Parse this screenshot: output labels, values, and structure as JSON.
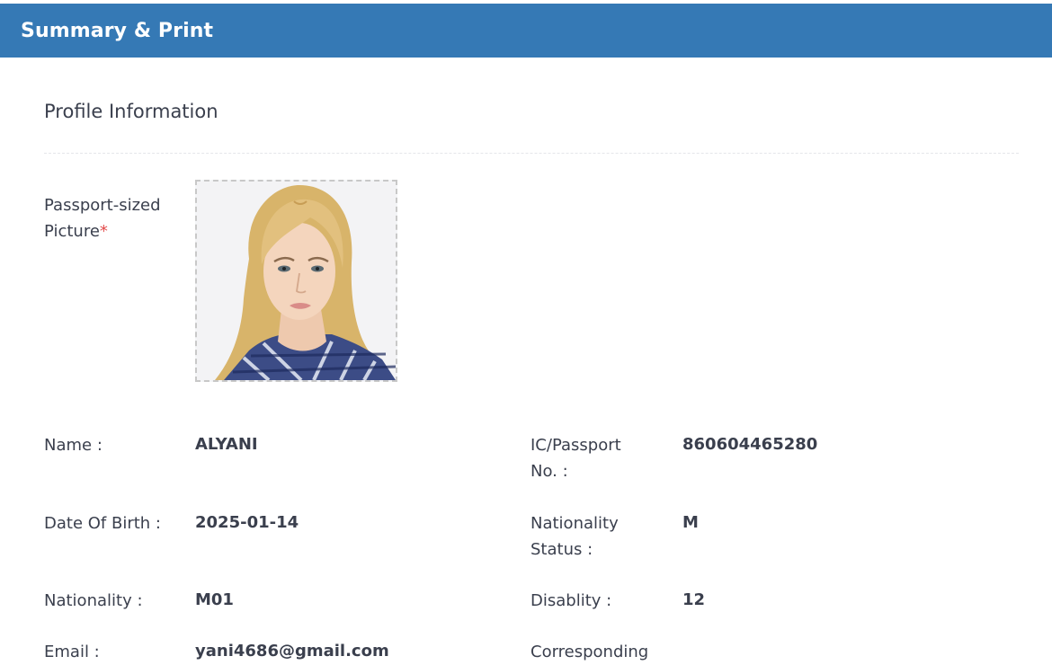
{
  "header": {
    "title": "Summary & Print"
  },
  "profile": {
    "section_title": "Profile Information",
    "photo_label": "Passport-sized Picture",
    "photo_required": "*"
  },
  "fields_left": [
    {
      "label": "Name :",
      "value": "ALYANI"
    },
    {
      "label": "Date Of Birth :",
      "value": "2025-01-14"
    },
    {
      "label": "Nationality :",
      "value": "M01"
    },
    {
      "label": "Email :",
      "value": "yani4686@gmail.com"
    }
  ],
  "fields_right": [
    {
      "label": "IC/Passport No. :",
      "value": "860604465280"
    },
    {
      "label": "Nationality Status :",
      "value": "M"
    },
    {
      "label": "Disablity :",
      "value": "12"
    },
    {
      "label": "Corresponding",
      "value": ""
    }
  ],
  "colors": {
    "header_bg": "#3579b5",
    "text": "#3a3f4d",
    "required": "#e24b4b"
  }
}
